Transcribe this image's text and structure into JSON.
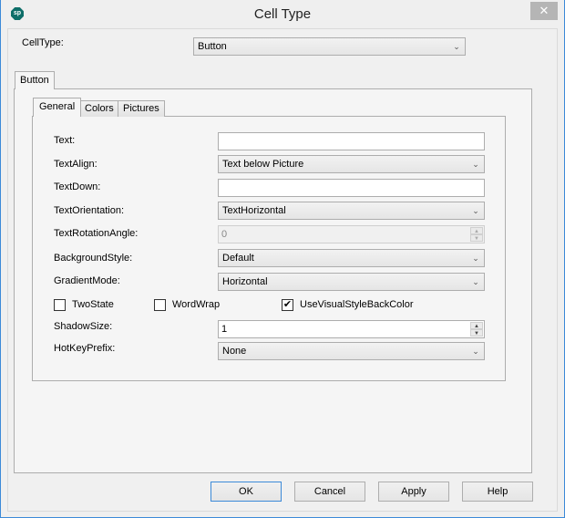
{
  "window": {
    "title": "Cell Type",
    "app_icon_text": "sp",
    "close_glyph": "✕"
  },
  "celltype": {
    "label": "CellType:",
    "value": "Button"
  },
  "outer_tab": {
    "label": "Button"
  },
  "inner_tabs": [
    {
      "label": "General",
      "active": true
    },
    {
      "label": "Colors",
      "active": false
    },
    {
      "label": "Pictures",
      "active": false
    }
  ],
  "fields": {
    "text": {
      "label": "Text:",
      "value": ""
    },
    "text_align": {
      "label": "TextAlign:",
      "value": "Text below Picture"
    },
    "text_down": {
      "label": "TextDown:",
      "value": ""
    },
    "text_orientation": {
      "label": "TextOrientation:",
      "value": "TextHorizontal"
    },
    "text_rotation_angle": {
      "label": "TextRotationAngle:",
      "value": "0",
      "disabled": true
    },
    "background_style": {
      "label": "BackgroundStyle:",
      "value": "Default"
    },
    "gradient_mode": {
      "label": "GradientMode:",
      "value": "Horizontal"
    },
    "shadow_size": {
      "label": "ShadowSize:",
      "value": "1"
    },
    "hotkey_prefix": {
      "label": "HotKeyPrefix:",
      "value": "None"
    }
  },
  "checkboxes": {
    "two_state": {
      "label": "TwoState",
      "checked": false,
      "mark": ""
    },
    "word_wrap": {
      "label": "WordWrap",
      "checked": false,
      "mark": ""
    },
    "use_visual_style_back_color": {
      "label": "UseVisualStyleBackColor",
      "checked": true,
      "mark": "✔"
    }
  },
  "icons": {
    "chevron": "⌄",
    "spin_up": "▲",
    "spin_down": "▼"
  },
  "buttons": {
    "ok": "OK",
    "cancel": "Cancel",
    "apply": "Apply",
    "help": "Help"
  }
}
